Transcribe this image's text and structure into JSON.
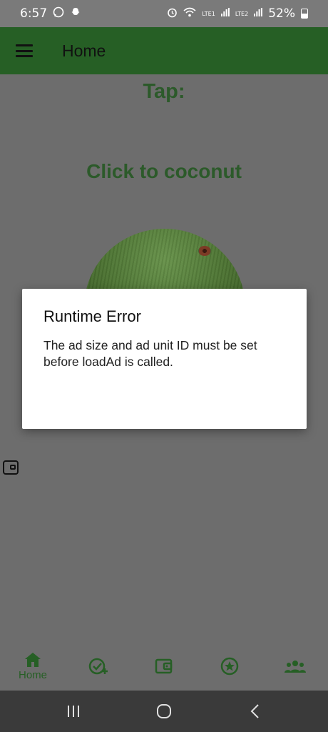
{
  "status_bar": {
    "time": "6:57",
    "left_icons": [
      "whatsapp-icon",
      "snapchat-icon"
    ],
    "right_icons": [
      "alarm-icon",
      "wifi-icon",
      "volte1-icon",
      "signal1-icon",
      "volte2-icon",
      "signal2-icon"
    ],
    "lte1": "LTE1",
    "lte2": "LTE2",
    "battery": "52%"
  },
  "app_bar": {
    "title": "Home",
    "menu_icon": "hamburger-menu-icon"
  },
  "main": {
    "tap_label": "Tap:",
    "click_label": "Click to coconut",
    "coconut_icon": "coconut-image",
    "side_icon": "wallet-icon"
  },
  "dialog": {
    "title": "Runtime Error",
    "message": "The ad size and ad unit ID must be set before loadAd is called."
  },
  "bottom_nav": {
    "items": [
      {
        "label": "Home",
        "icon": "home-icon"
      },
      {
        "label": "",
        "icon": "check-add-icon"
      },
      {
        "label": "",
        "icon": "wallet-icon"
      },
      {
        "label": "",
        "icon": "star-circle-icon"
      },
      {
        "label": "",
        "icon": "group-icon"
      }
    ]
  },
  "system_nav": {
    "icons": [
      "recent-apps-icon",
      "home-circle-icon",
      "back-icon"
    ]
  },
  "colors": {
    "primary": "#265f25",
    "scrim": "#6d6d6d",
    "text_green": "#2c5a2a"
  }
}
